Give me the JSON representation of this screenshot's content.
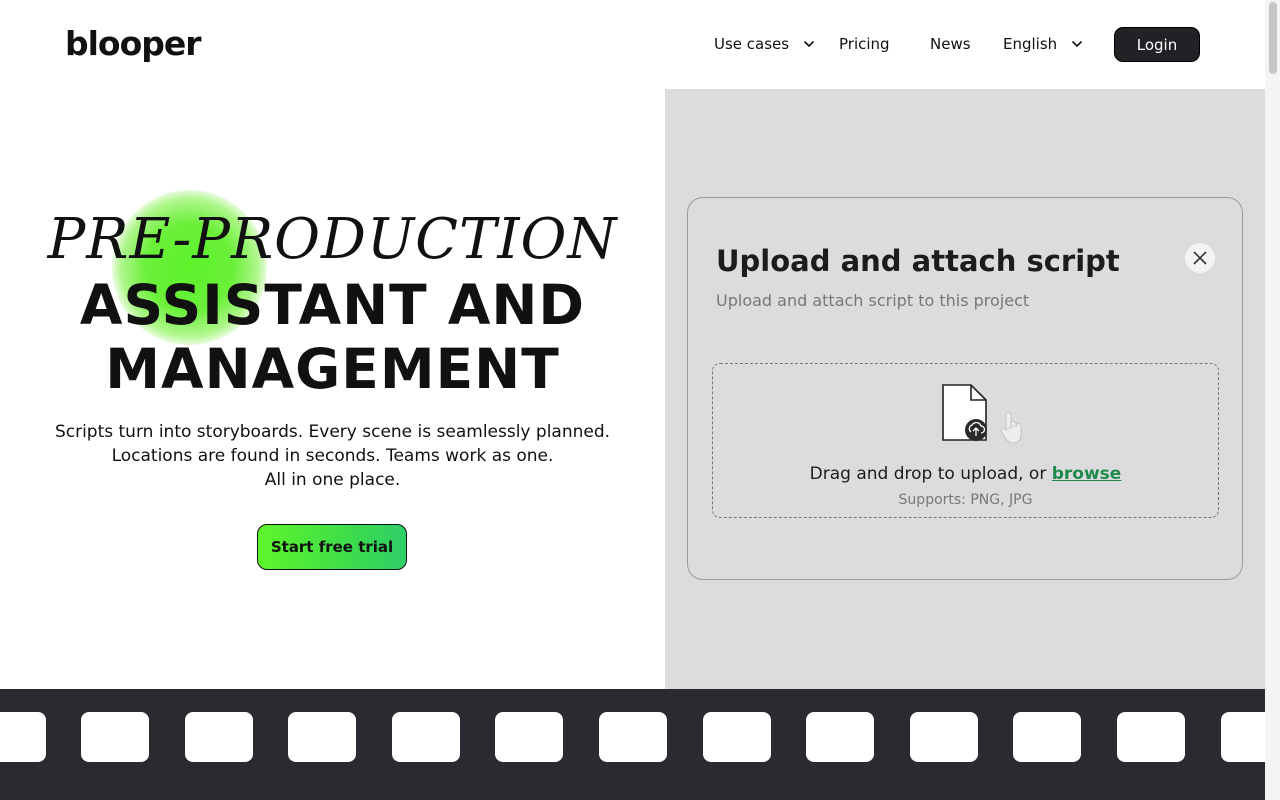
{
  "header": {
    "logo": "blooper",
    "nav": {
      "use_cases": "Use cases",
      "pricing": "Pricing",
      "news": "News",
      "language": "English"
    },
    "login_label": "Login"
  },
  "hero": {
    "title_line1": "PRE-PRODUCTION",
    "title_line2": "ASSISTANT AND",
    "title_line3": "MANAGEMENT",
    "subtitle_lines": [
      "Scripts turn into storyboards. Every scene is seamlessly planned.",
      "Locations are found in seconds. Teams work as one.",
      "All in one place."
    ],
    "cta_label": "Start free trial"
  },
  "upload_modal": {
    "title": "Upload and attach script",
    "subtitle": "Upload and attach script to this project",
    "drop_text": "Drag and drop to upload, or",
    "browse_label": "browse",
    "supports": "Supports: PNG, JPG"
  },
  "icons": {
    "close": "close-icon",
    "file": "file-upload-icon",
    "cursor": "hand-cursor-icon",
    "chevron": "chevron-down-icon"
  },
  "colors": {
    "accent_green": "#5ef52b",
    "link_green": "#1f8a4c",
    "dark": "#222226",
    "panel_gray": "#dcdcde"
  }
}
